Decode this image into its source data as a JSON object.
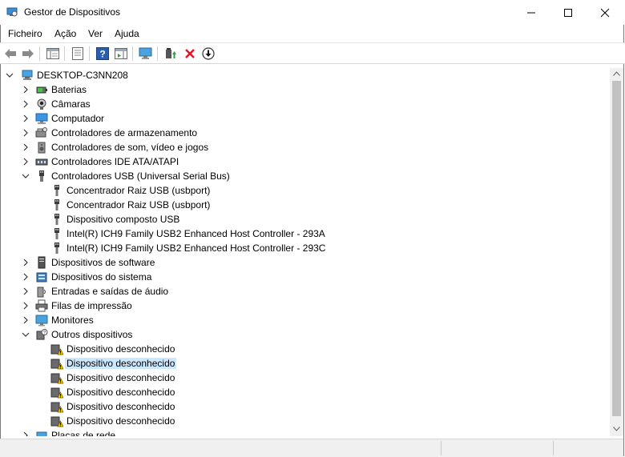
{
  "window": {
    "title": "Gestor de Dispositivos",
    "minimize_icon": "minimize-icon",
    "maximize_icon": "maximize-icon",
    "close_icon": "close-icon"
  },
  "menu": [
    "Ficheiro",
    "Ação",
    "Ver",
    "Ajuda"
  ],
  "toolbar": [
    "back-arrow-icon",
    "forward-arrow-icon",
    "properties-list-icon",
    "properties-page-icon",
    "help-icon",
    "action-pane-icon",
    "monitor-scan-icon",
    "update-driver-icon",
    "uninstall-x-icon",
    "download-circle-icon"
  ],
  "tree": {
    "root": "DESKTOP-C3NN208",
    "nodes": [
      {
        "label": "Baterias",
        "icon": "battery-icon",
        "expanded": false
      },
      {
        "label": "Câmaras",
        "icon": "camera-icon",
        "expanded": false
      },
      {
        "label": "Computador",
        "icon": "computer-icon",
        "expanded": false
      },
      {
        "label": "Controladores de armazenamento",
        "icon": "storage-controller-icon",
        "expanded": false
      },
      {
        "label": "Controladores de som, vídeo e jogos",
        "icon": "speaker-icon",
        "expanded": false
      },
      {
        "label": "Controladores IDE ATA/ATAPI",
        "icon": "ide-controller-icon",
        "expanded": false
      },
      {
        "label": "Controladores USB (Universal Serial Bus)",
        "icon": "usb-icon",
        "expanded": true,
        "children": [
          "Concentrador Raiz USB (usbport)",
          "Concentrador Raiz USB (usbport)",
          "Dispositivo composto USB",
          "Intel(R) ICH9 Family USB2 Enhanced Host Controller - 293A",
          "Intel(R) ICH9 Family USB2 Enhanced Host Controller - 293C"
        ]
      },
      {
        "label": "Dispositivos de software",
        "icon": "software-device-icon",
        "expanded": false
      },
      {
        "label": "Dispositivos do sistema",
        "icon": "system-device-icon",
        "expanded": false
      },
      {
        "label": "Entradas e saídas de áudio",
        "icon": "audio-io-icon",
        "expanded": false
      },
      {
        "label": "Filas de impressão",
        "icon": "printer-icon",
        "expanded": false
      },
      {
        "label": "Monitores",
        "icon": "monitor-icon",
        "expanded": false
      },
      {
        "label": "Outros dispositivos",
        "icon": "unknown-device-icon",
        "expanded": true,
        "children": [
          "Dispositivo desconhecido",
          "Dispositivo desconhecido",
          "Dispositivo desconhecido",
          "Dispositivo desconhecido",
          "Dispositivo desconhecido",
          "Dispositivo desconhecido"
        ],
        "selected_child_index": 1
      },
      {
        "label": "Placas de rede",
        "icon": "network-adapter-icon",
        "expanded": false
      }
    ]
  },
  "colors": {
    "selection": "#cce8ff",
    "warning": "#f2c811",
    "uninstall_red": "#e81123",
    "accent_blue": "#1e73be"
  }
}
